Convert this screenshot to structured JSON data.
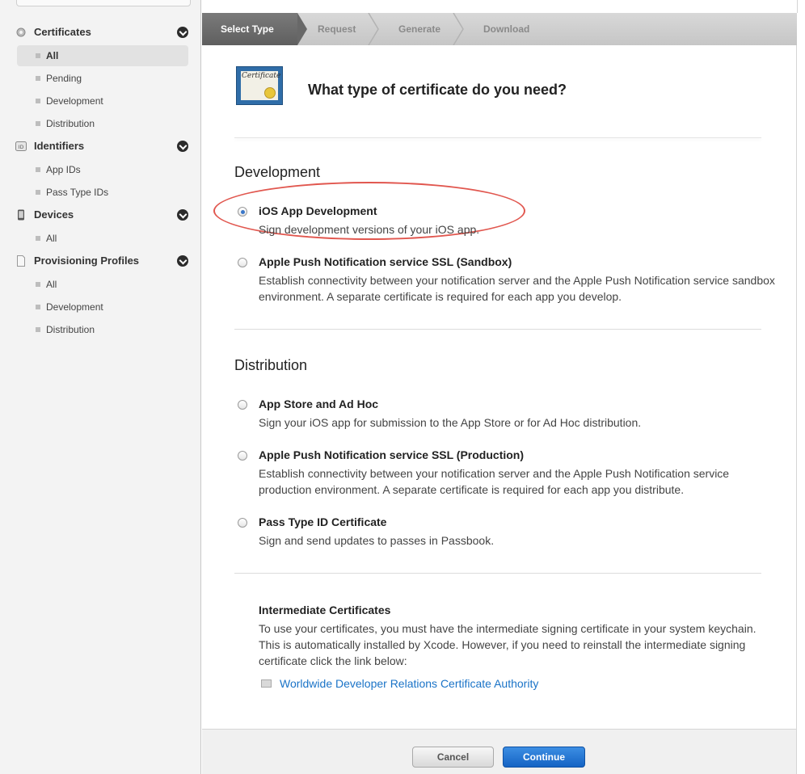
{
  "sidebar": {
    "groups": [
      {
        "label": "Certificates",
        "icon": "certificate-gear-icon",
        "items": [
          {
            "label": "All",
            "active": true
          },
          {
            "label": "Pending"
          },
          {
            "label": "Development"
          },
          {
            "label": "Distribution"
          }
        ]
      },
      {
        "label": "Identifiers",
        "icon": "id-badge-icon",
        "items": [
          {
            "label": "App IDs"
          },
          {
            "label": "Pass Type IDs"
          }
        ]
      },
      {
        "label": "Devices",
        "icon": "iphone-icon",
        "items": [
          {
            "label": "All"
          }
        ]
      },
      {
        "label": "Provisioning Profiles",
        "icon": "document-icon",
        "items": [
          {
            "label": "All"
          },
          {
            "label": "Development"
          },
          {
            "label": "Distribution"
          }
        ]
      }
    ]
  },
  "steps": [
    "Select Type",
    "Request",
    "Generate",
    "Download"
  ],
  "active_step": 0,
  "cert_icon_text": "Certificate",
  "question": "What type of certificate do you need?",
  "development": {
    "title": "Development",
    "options": [
      {
        "title": "iOS App Development",
        "desc": "Sign development versions of your iOS app.",
        "checked": true
      },
      {
        "title": "Apple Push Notification service SSL (Sandbox)",
        "desc": "Establish connectivity between your notification server and the Apple Push Notification service sandbox environment. A separate certificate is required for each app you develop."
      }
    ]
  },
  "distribution": {
    "title": "Distribution",
    "options": [
      {
        "title": "App Store and Ad Hoc",
        "desc": "Sign your iOS app for submission to the App Store or for Ad Hoc distribution."
      },
      {
        "title": "Apple Push Notification service SSL (Production)",
        "desc": "Establish connectivity between your notification server and the Apple Push Notification service production environment. A separate certificate is required for each app you distribute."
      },
      {
        "title": "Pass Type ID Certificate",
        "desc": "Sign and send updates to passes in Passbook."
      }
    ]
  },
  "intermediate": {
    "title": "Intermediate Certificates",
    "desc": "To use your certificates, you must have the intermediate signing certificate in your system keychain. This is automatically installed by Xcode. However, if you need to reinstall the intermediate signing certificate click the link below:",
    "link": "Worldwide Developer Relations Certificate Authority"
  },
  "footer": {
    "cancel": "Cancel",
    "continue": "Continue"
  },
  "colors": {
    "accent": "#1a73c7",
    "highlight": "#e1574f",
    "continue_button": "#1563c4"
  }
}
